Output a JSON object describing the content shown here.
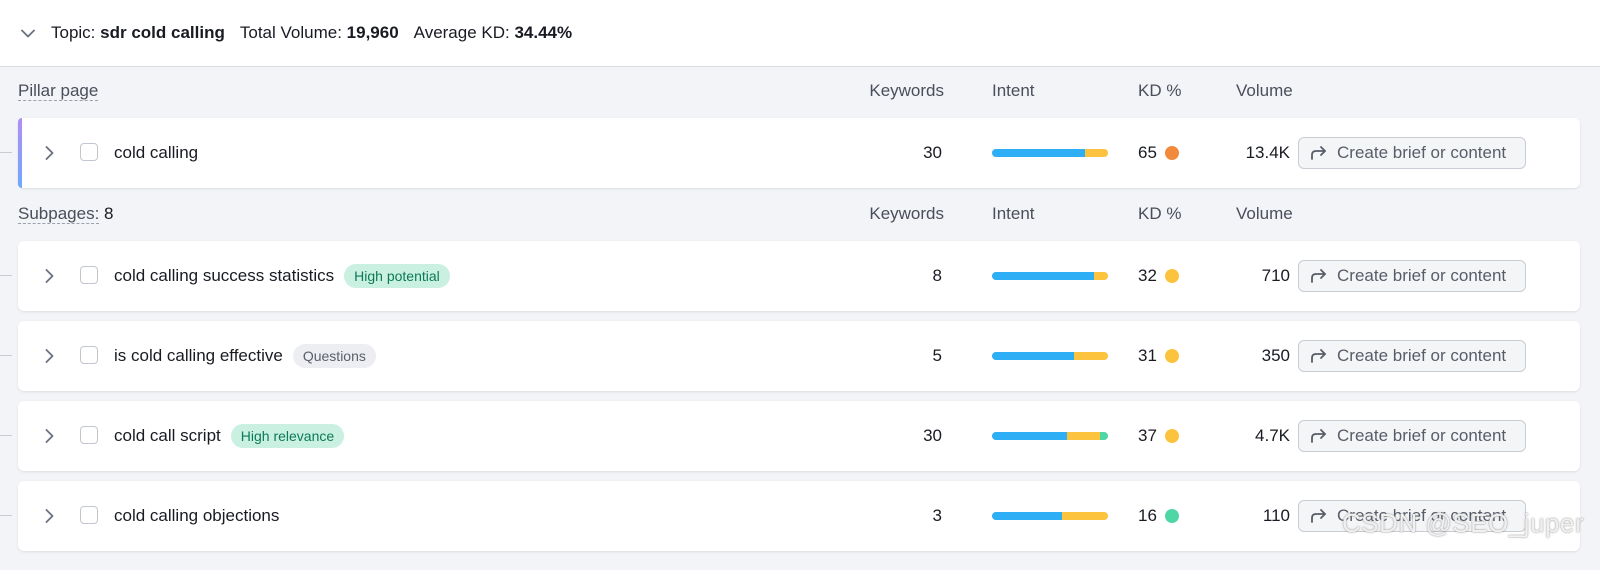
{
  "topic": {
    "topic_label": "Topic:",
    "topic_value": "sdr cold calling",
    "volume_label": "Total Volume:",
    "volume_value": "19,960",
    "kd_label": "Average KD:",
    "kd_value": "34.44%"
  },
  "columns": {
    "keywords": "Keywords",
    "intent": "Intent",
    "kd": "KD %",
    "volume": "Volume"
  },
  "pillar": {
    "section_title": "Pillar page",
    "row": {
      "name": "cold calling",
      "keywords": "30",
      "intent": [
        {
          "pct": 80,
          "color": "#2eaef5"
        },
        {
          "pct": 20,
          "color": "#fcc43e"
        }
      ],
      "kd": "65",
      "kd_color": "#f28a3d",
      "volume": "13.4K",
      "cta": "Create brief or content"
    }
  },
  "subpages": {
    "section_title": "Subpages:",
    "count": "8",
    "rows": [
      {
        "name": "cold calling success statistics",
        "badge": "High potential",
        "badge_style": "green",
        "keywords": "8",
        "intent": [
          {
            "pct": 88,
            "color": "#2eaef5"
          },
          {
            "pct": 12,
            "color": "#fcc43e"
          }
        ],
        "kd": "32",
        "kd_color": "#fcc43e",
        "volume": "710",
        "cta": "Create brief or content"
      },
      {
        "name": "is cold calling effective",
        "badge": "Questions",
        "badge_style": "gray",
        "keywords": "5",
        "intent": [
          {
            "pct": 71,
            "color": "#2eaef5"
          },
          {
            "pct": 29,
            "color": "#fcc43e"
          }
        ],
        "kd": "31",
        "kd_color": "#fcc43e",
        "volume": "350",
        "cta": "Create brief or content"
      },
      {
        "name": "cold call script",
        "badge": "High relevance",
        "badge_style": "green",
        "keywords": "30",
        "intent": [
          {
            "pct": 65,
            "color": "#2eaef5"
          },
          {
            "pct": 28,
            "color": "#fcc43e"
          },
          {
            "pct": 7,
            "color": "#4fd6a5"
          }
        ],
        "kd": "37",
        "kd_color": "#fcc43e",
        "volume": "4.7K",
        "cta": "Create brief or content"
      },
      {
        "name": "cold calling objections",
        "badge": "",
        "badge_style": "",
        "keywords": "3",
        "intent": [
          {
            "pct": 60,
            "color": "#2eaef5"
          },
          {
            "pct": 40,
            "color": "#fcc43e"
          }
        ],
        "kd": "16",
        "kd_color": "#4fd6a5",
        "volume": "110",
        "cta": "Create brief or content"
      }
    ]
  },
  "watermark": "CSDN @SEO_juper"
}
